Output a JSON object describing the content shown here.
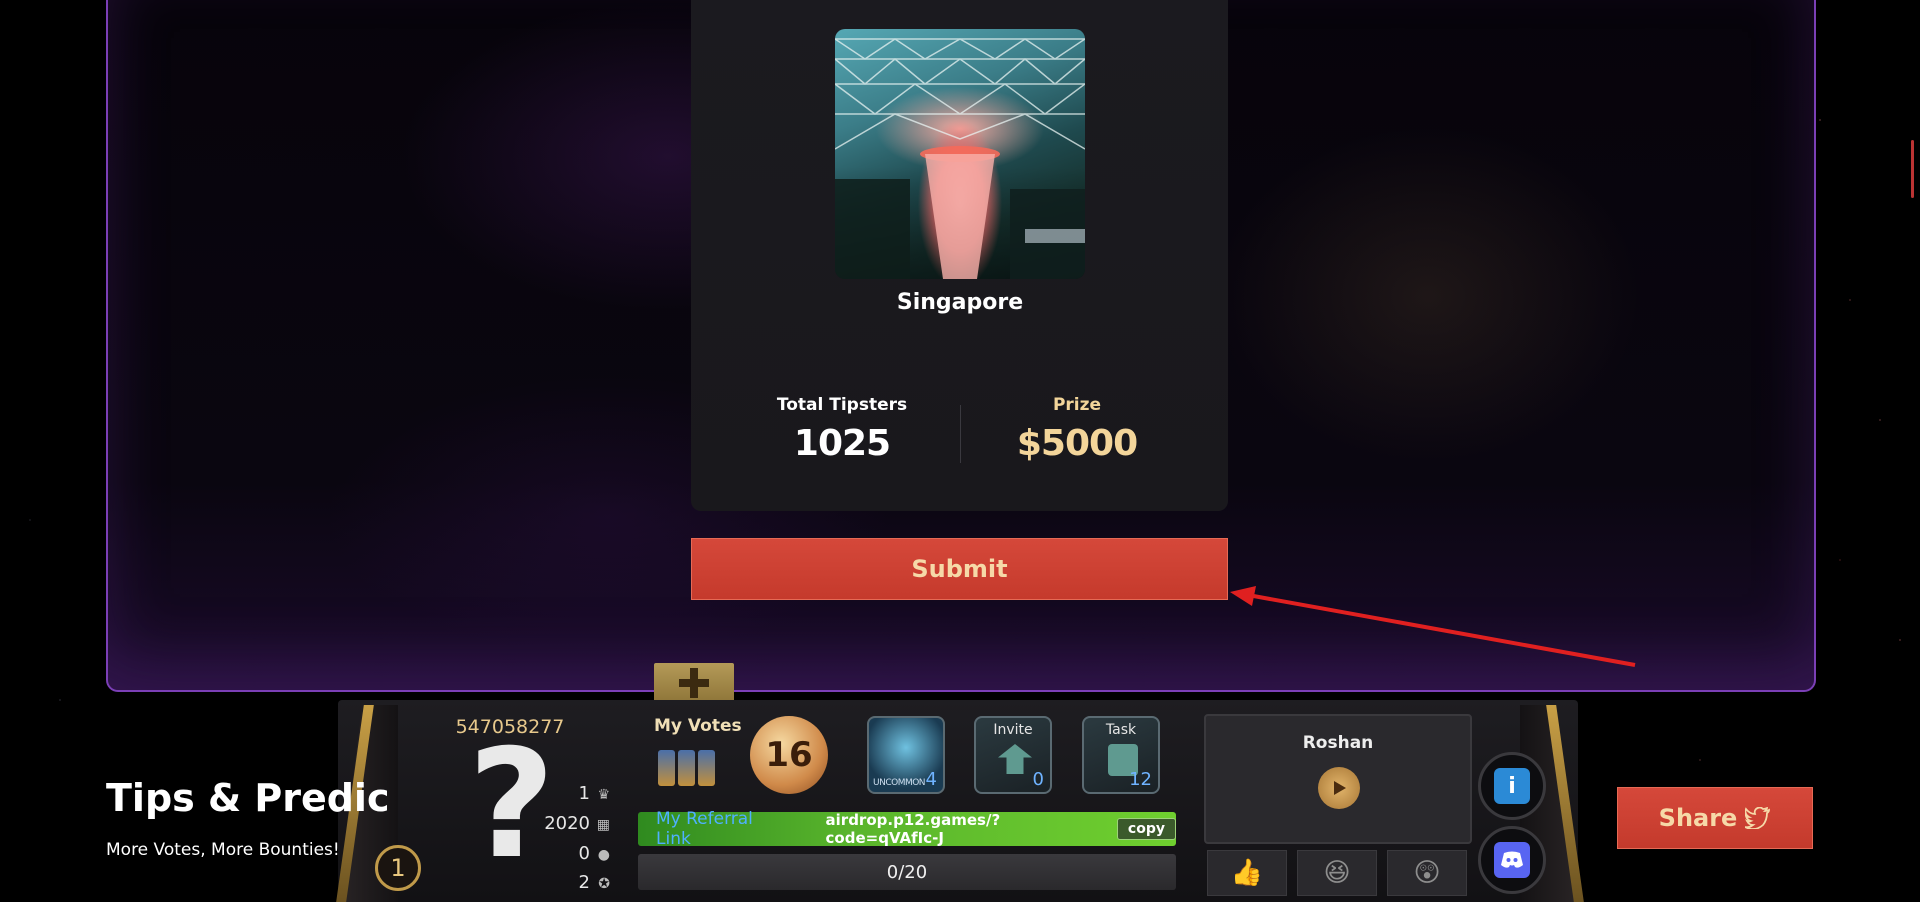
{
  "card": {
    "city": "Singapore",
    "stats": [
      {
        "label": "Total Tipsters",
        "value": "1025"
      },
      {
        "label": "Prize",
        "value": "$5000"
      }
    ],
    "submit_label": "Submit"
  },
  "colors": {
    "accent": "#d5483a",
    "prize": "#f3d59a",
    "frame": "#7b3fb6",
    "gold": "#c9a046"
  },
  "profile": {
    "player_id": "547058277",
    "level": "1",
    "stats": [
      {
        "value": "1",
        "icon": "crown-icon"
      },
      {
        "value": "2020",
        "icon": "calendar-icon"
      },
      {
        "value": "0",
        "icon": "user-icon"
      },
      {
        "value": "2",
        "icon": "badge-icon"
      }
    ]
  },
  "votes": {
    "label": "My Votes",
    "count": "16",
    "tiles": [
      {
        "title": "",
        "word": "UNCOMMON",
        "count": "4"
      },
      {
        "title": "Invite",
        "count": "0"
      },
      {
        "title": "Task",
        "count": "12"
      }
    ]
  },
  "referral": {
    "label": "My Referral Link",
    "url": "airdrop.p12.games/?code=qVAfIc-J",
    "copy_label": "copy"
  },
  "progress": {
    "text": "0/20",
    "value": 0,
    "max": 20
  },
  "npc": {
    "name": "Roshan"
  },
  "tips": {
    "title": "Tips & Predic",
    "subtitle": "More Votes, More Bounties!"
  },
  "share": {
    "label": "Share"
  }
}
